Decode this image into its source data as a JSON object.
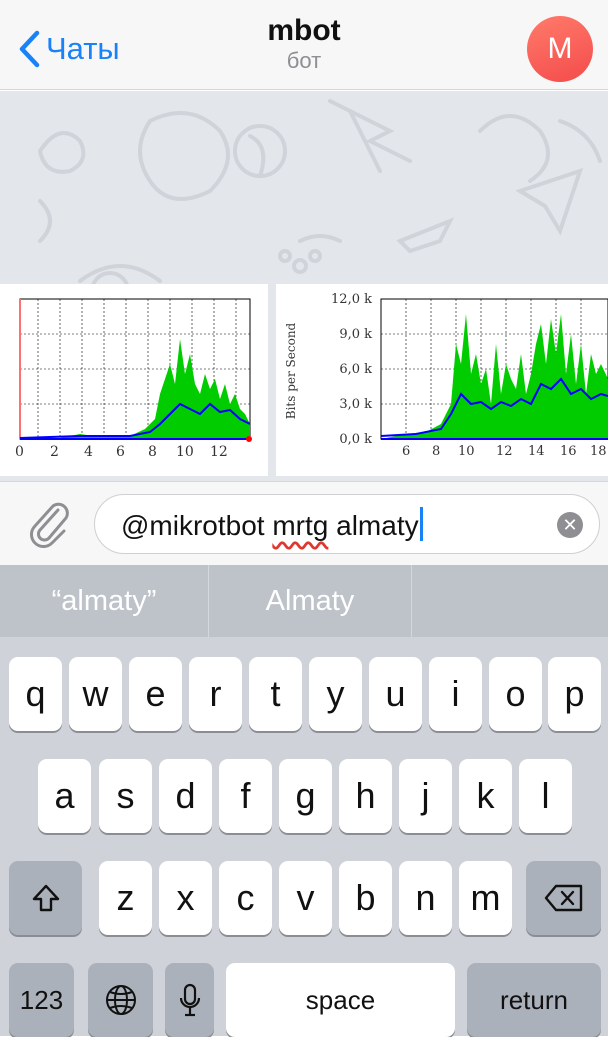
{
  "header": {
    "back_label": "Чаты",
    "title": "mbot",
    "subtitle": "бот",
    "avatar_letter": "M"
  },
  "graphs": {
    "left": {
      "x_ticks": [
        "0",
        "2",
        "4",
        "6",
        "8",
        "10",
        "12"
      ]
    },
    "right": {
      "y_ticks": [
        "12,0 k",
        "9,0 k",
        "6,0 k",
        "3,0 k",
        "0,0 k"
      ],
      "y_label": "Bits per Second",
      "x_ticks": [
        "6",
        "8",
        "10",
        "12",
        "14",
        "16",
        "18"
      ]
    }
  },
  "input": {
    "text_prefix": "@mikrotbot ",
    "text_misspelled": "mrtg",
    "text_suffix": " almaty"
  },
  "keyboard": {
    "suggestions": [
      "“almaty”",
      "Almaty",
      ""
    ],
    "row1": [
      "q",
      "w",
      "e",
      "r",
      "t",
      "y",
      "u",
      "i",
      "o",
      "p"
    ],
    "row2": [
      "a",
      "s",
      "d",
      "f",
      "g",
      "h",
      "j",
      "k",
      "l"
    ],
    "row3": [
      "z",
      "x",
      "c",
      "v",
      "b",
      "n",
      "m"
    ],
    "numbers_label": "123",
    "space_label": "space",
    "return_label": "return"
  },
  "colors": {
    "accent": "#1a82f7",
    "graph_green": "#00cc00",
    "graph_blue": "#0000ff"
  }
}
